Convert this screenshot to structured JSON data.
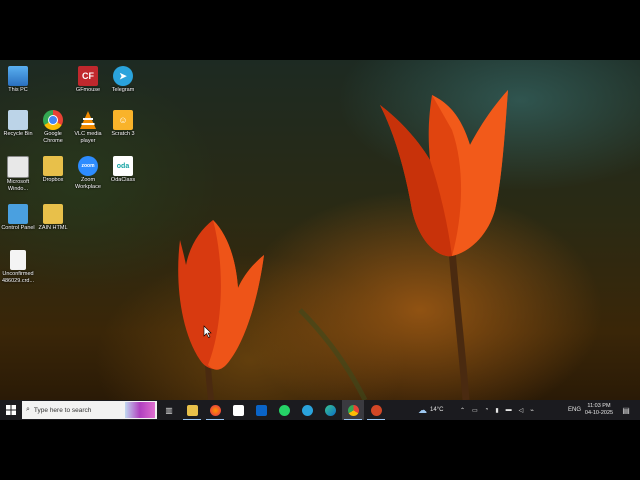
{
  "desktop": {
    "icons": [
      {
        "label": "This PC",
        "icon": "pc-icon",
        "color": "#3a8fd8"
      },
      {
        "label": "GFmouse",
        "icon": "cf-icon",
        "color": "#c0282d",
        "glyph": "CF"
      },
      {
        "label": "Telegram",
        "icon": "telegram-icon",
        "color": "#2aa3dc"
      },
      {
        "label": "Recycle Bin",
        "icon": "recycle-bin-icon",
        "color": "#bcd4e8"
      },
      {
        "label": "Google Chrome",
        "icon": "chrome-icon",
        "color": "#e94235"
      },
      {
        "label": "VLC media player",
        "icon": "vlc-icon",
        "color": "#f08a00"
      },
      {
        "label": "Scratch 3",
        "icon": "scratch-icon",
        "color": "#f9b32a"
      },
      {
        "label": "Microsoft Windo...",
        "icon": "notepad-icon",
        "color": "#e8e8e8"
      },
      {
        "label": "Dropbox",
        "icon": "folder-icon",
        "color": "#e8c04a"
      },
      {
        "label": "Zoom Workplace",
        "icon": "zoom-icon",
        "color": "#2d8cff",
        "glyph": "zoom"
      },
      {
        "label": "OdaClass",
        "icon": "odaclass-icon",
        "color": "#ffffff",
        "glyph": "oda"
      },
      {
        "label": "Control Panel",
        "icon": "control-panel-icon",
        "color": "#4aa0e0"
      },
      {
        "label": "ZAIN HTML",
        "icon": "folder-icon",
        "color": "#e8c04a"
      },
      {
        "label": "Unconfirmed 486029.crd...",
        "icon": "file-icon",
        "color": "#f4f4f4"
      }
    ]
  },
  "taskbar": {
    "search_placeholder": "Type here to search",
    "weather": "14°C",
    "language": "ENG",
    "time": "11:03 PM",
    "date": "04-10-2025"
  }
}
